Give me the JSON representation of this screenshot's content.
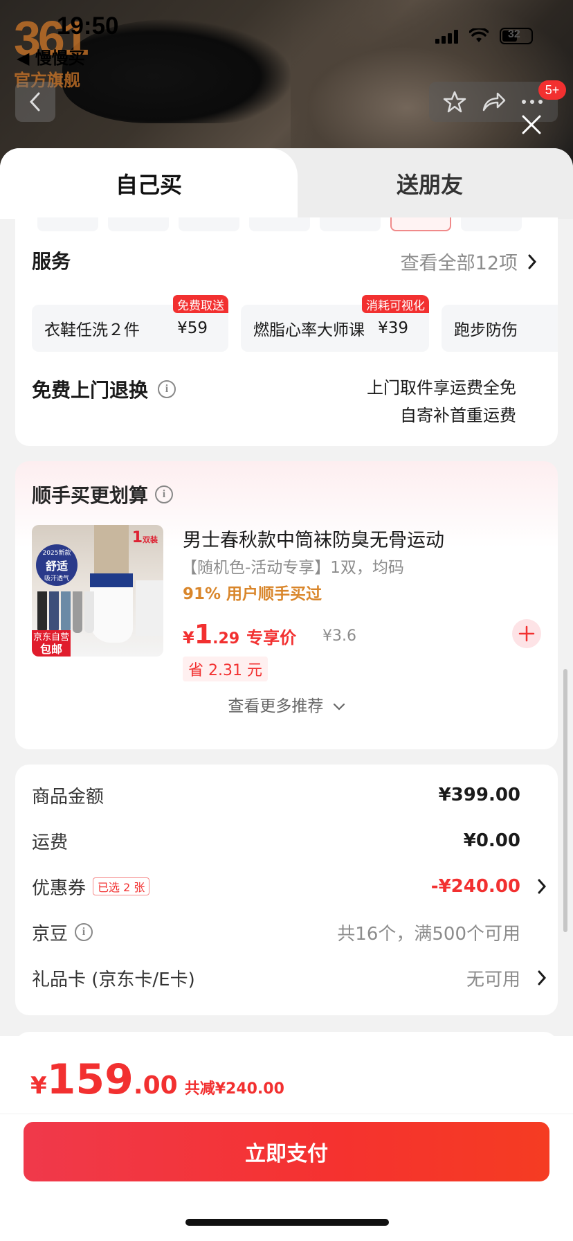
{
  "status_bar": {
    "time": "19:50",
    "back_app": "◀ 慢慢买",
    "battery_percent": "32"
  },
  "brand": {
    "logo_number": "361",
    "logo_text": "官方旗舰"
  },
  "header": {
    "badge_count": "5+"
  },
  "tabs": {
    "self": "自己买",
    "gift": "送朋友"
  },
  "service": {
    "title": "服务",
    "view_all": "查看全部12项",
    "items": [
      {
        "name": "衣鞋任洗２件",
        "price": "¥59",
        "tag": "免费取送"
      },
      {
        "name": "燃脂心率大师课",
        "price": "¥39",
        "tag": "消耗可视化"
      },
      {
        "name": "跑步防伤",
        "price": "",
        "tag": ""
      }
    ]
  },
  "return_policy": {
    "title": "免费上门退换",
    "line1": "上门取件享运费全免",
    "line2": "自寄补首重运费"
  },
  "recommend": {
    "title": "顺手买更划算",
    "product_name": "男士春秋款中筒袜防臭无骨运动",
    "spec": "【随机色-活动专享】1双，均码",
    "bought": "91% 用户顺手买过",
    "price_symbol": "¥",
    "price_int": "1",
    "price_dec": ".29",
    "price_label": "专享价",
    "original_price": "¥3.6",
    "save": "省 2.31 元",
    "more": "查看更多推荐",
    "image_text": {
      "badge_year": "2025新款",
      "badge_main": "舒适",
      "badge_sub": "吸汗透气",
      "count": "1",
      "count_unit": "双装",
      "jd_tag_line1": "京东自营",
      "jd_tag_line2": "包邮"
    }
  },
  "summary": {
    "goods_label": "商品金额",
    "goods_value": "¥399.00",
    "shipping_label": "运费",
    "shipping_value": "¥0.00",
    "coupon_label": "优惠券",
    "coupon_tag": "已选 2 张",
    "coupon_value": "-¥240.00",
    "jingdou_label": "京豆",
    "jingdou_value": "共16个，满500个可用",
    "giftcard_label": "礼品卡 (京东卡/E卡)",
    "giftcard_value": "无可用"
  },
  "checkout": {
    "currency": "¥",
    "total_int": "159",
    "total_dec": ".00",
    "reduce": "共减¥240.00",
    "pay_button": "立即支付"
  },
  "colors": {
    "accent_red": "#f23030",
    "orange": "#d9862b"
  }
}
